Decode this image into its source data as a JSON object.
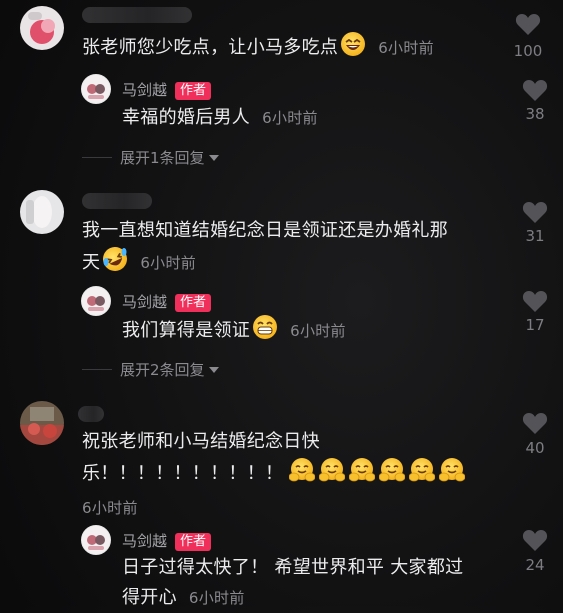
{
  "comments": [
    {
      "text": "张老师您少吃点，让小马多吃点",
      "time": "6小时前",
      "likes": "100",
      "reply": {
        "name": "马剑越",
        "badge": "作者",
        "text": "幸福的婚后男人",
        "time": "6小时前",
        "likes": "38"
      },
      "expand": "展开1条回复"
    },
    {
      "text_line1": "我一直想知道结婚纪念日是领证还是办婚礼那",
      "text_line2": "天",
      "time": "6小时前",
      "likes": "31",
      "reply": {
        "name": "马剑越",
        "badge": "作者",
        "text": "我们算得是领证",
        "time": "6小时前",
        "likes": "17"
      },
      "expand": "展开2条回复"
    },
    {
      "text_line1": "祝张老师和小马结婚纪念日快",
      "text_line2": "乐！！！！！！！！！！",
      "time": "6小时前",
      "likes": "40",
      "reply": {
        "name": "马剑越",
        "badge": "作者",
        "text_line1": "日子过得太快了！ 希望世界和平 大家都过",
        "text_line2": "得开心",
        "time": "6小时前",
        "likes": "24"
      }
    }
  ],
  "icons": {
    "like": "heart-icon",
    "expand": "caret-down-icon"
  }
}
